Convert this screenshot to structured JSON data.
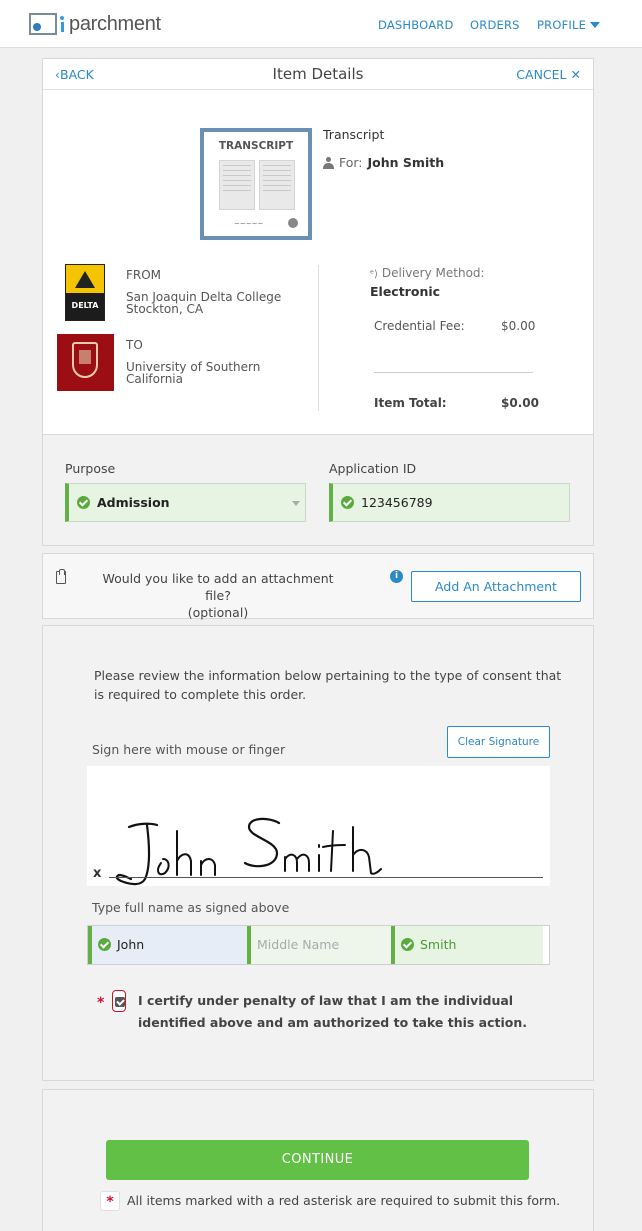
{
  "header": {
    "logo_text": "parchment",
    "nav": [
      {
        "label": "DASHBOARD"
      },
      {
        "label": "ORDERS"
      },
      {
        "label": "PROFILE"
      }
    ]
  },
  "item_details": {
    "back_label": "BACK",
    "title": "Item Details",
    "cancel_label": "CANCEL",
    "transcript_thumb_label": "TRANSCRIPT",
    "document_type": "Transcript",
    "for_label": "For:",
    "for_name": "John Smith",
    "from_label": "FROM",
    "from_institution_line1": "San Joaquin Delta College",
    "from_institution_line2": "Stockton, CA",
    "from_logo_text": "DELTA",
    "to_label": "TO",
    "to_institution_line1": "University of Southern",
    "to_institution_line2": "California",
    "delivery_method_label": "Delivery Method:",
    "delivery_method_value": "Electronic",
    "credential_fee_label": "Credential Fee:",
    "credential_fee_value": "$0.00",
    "item_total_label": "Item Total:",
    "item_total_value": "$0.00"
  },
  "purpose": {
    "purpose_label": "Purpose",
    "purpose_value": "Admission",
    "application_id_label": "Application ID",
    "application_id_value": "123456789"
  },
  "attachment": {
    "prompt_line1": "Would you like to add an attachment file?",
    "prompt_line2": "(optional)",
    "button_label": "Add An Attachment"
  },
  "consent": {
    "intro": "Please review the information below pertaining to the type of consent that is required to complete this order.",
    "sign_label": "Sign here with mouse or finger",
    "clear_button_label": "Clear Signature",
    "signature_x": "x",
    "typed_name_label": "Type full name as signed above",
    "first_name": "John",
    "middle_name_placeholder": "Middle Name",
    "last_name": "Smith",
    "certify_text": "I certify under penalty of law that I am the individual identified above and am authorized to take this action."
  },
  "footer": {
    "continue_label": "CONTINUE",
    "required_note": "All items marked with a red asterisk are required to submit this form."
  },
  "colors": {
    "link_blue": "#2a89c8",
    "valid_green": "#62b046",
    "continue_green": "#62c046",
    "required_red": "#d0112b"
  }
}
